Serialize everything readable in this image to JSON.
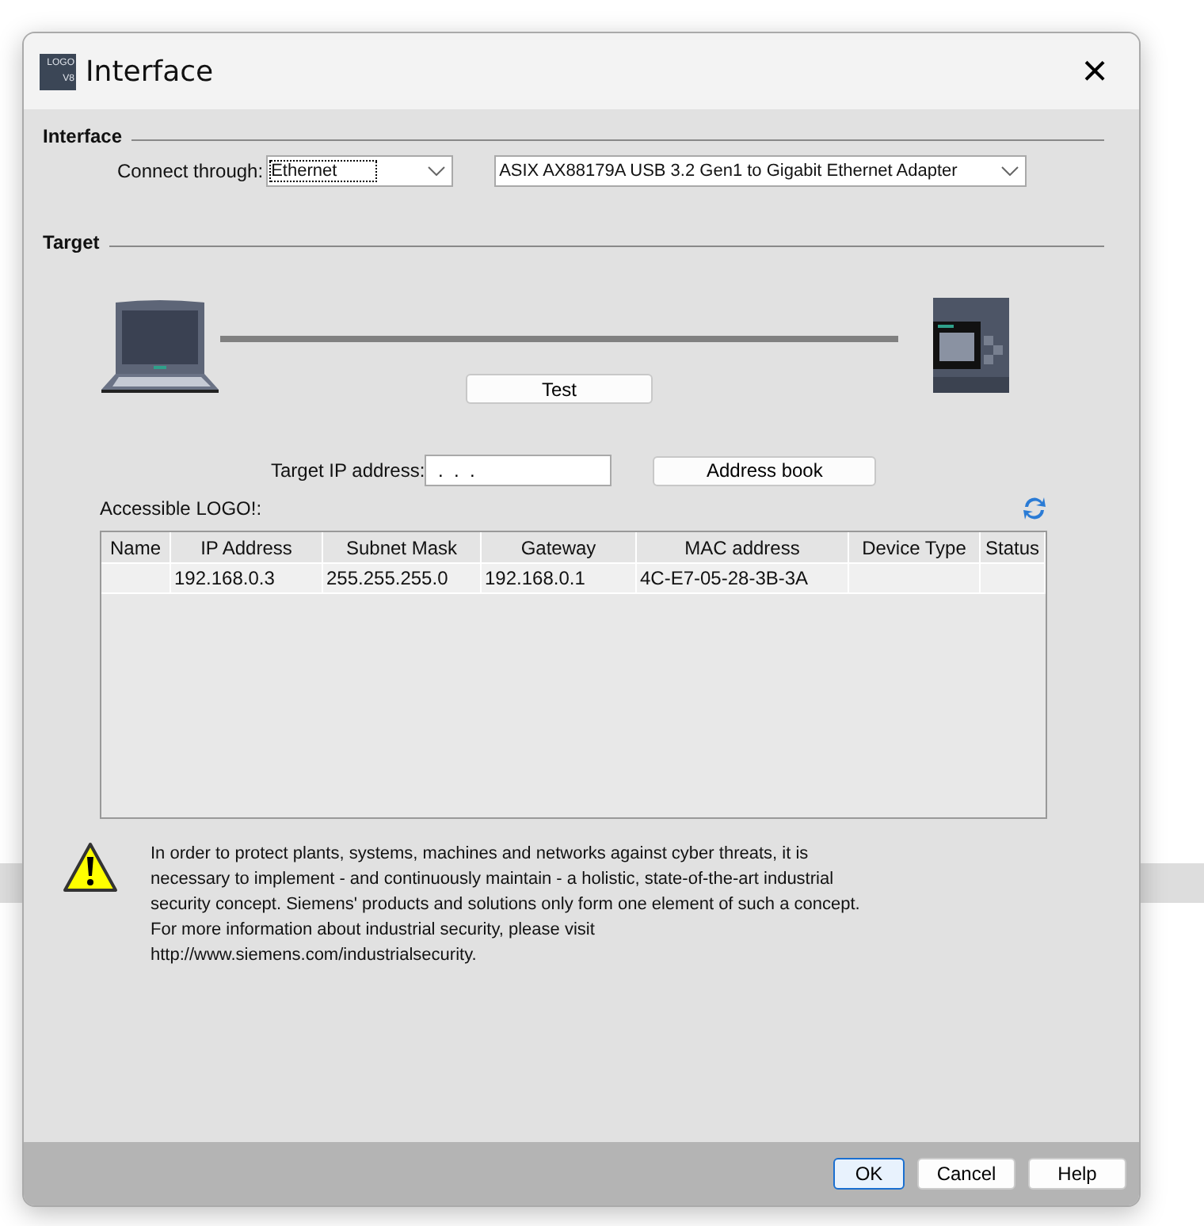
{
  "window": {
    "title": "Interface",
    "logo_top": "LOGO",
    "logo_bottom": "V8",
    "close": "×"
  },
  "interface_section": {
    "title": "Interface",
    "connect_label": "Connect through:",
    "connect_value": "Ethernet",
    "adapter_value": "ASIX AX88179A USB 3.2 Gen1 to Gigabit Ethernet Adapter"
  },
  "target_section": {
    "title": "Target",
    "test_button": "Test",
    "ip_label": "Target IP address:",
    "ip_value": " .  .  . ",
    "address_book_button": "Address book",
    "accessible_label": "Accessible LOGO!:"
  },
  "table": {
    "columns": [
      "Name",
      "IP Address",
      "Subnet Mask",
      "Gateway",
      "MAC address",
      "Device Type",
      "Status"
    ],
    "rows": [
      {
        "selected": false,
        "cells": [
          "",
          "192.168.0.3",
          "255.255.255.0",
          "192.168.0.1",
          "4C-E7-05-28-3B-3A",
          "",
          ""
        ]
      }
    ]
  },
  "warning": "In order to protect plants, systems, machines and networks against cyber threats, it is necessary to implement - and continuously maintain - a holistic, state-of-the-art industrial security concept. Siemens' products and solutions only form one element of such a concept. For more information about industrial security, please visit http://www.siemens.com/industrialsecurity.",
  "buttons": [
    {
      "label": "OK",
      "selected": true
    },
    {
      "label": "Cancel",
      "selected": false
    },
    {
      "label": "Help",
      "selected": false
    }
  ]
}
